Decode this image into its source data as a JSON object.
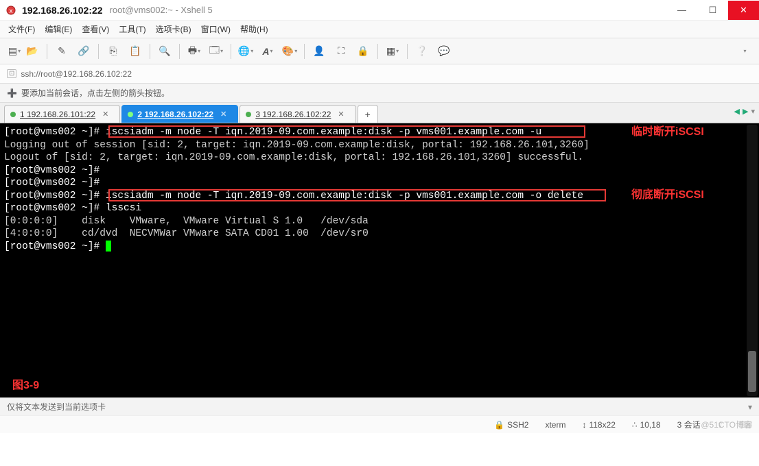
{
  "window": {
    "title_main": "192.168.26.102:22",
    "title_sub": "root@vms002:~ - Xshell 5"
  },
  "menu": {
    "file": "文件(F)",
    "edit": "编辑(E)",
    "view": "查看(V)",
    "tools": "工具(T)",
    "tab": "选项卡(B)",
    "window": "窗口(W)",
    "help": "帮助(H)"
  },
  "address": {
    "protocol_icon": "⍟",
    "url": "ssh://root@192.168.26.102:22"
  },
  "hint": {
    "text": "要添加当前会话，点击左侧的箭头按钮。"
  },
  "tabs": [
    {
      "label": "1 192.168.26.101:22",
      "active": false
    },
    {
      "label": "2 192.168.26.102:22",
      "active": true
    },
    {
      "label": "3 192.168.26.102:22",
      "active": false
    }
  ],
  "terminal": {
    "lines": [
      {
        "prompt": "[root@vms002 ~]#",
        "text": " iscsiadm -m node -T iqn.2019-09.com.example:disk -p vms001.example.com -u"
      },
      {
        "out": "Logging out of session [sid: 2, target: iqn.2019-09.com.example:disk, portal: 192.168.26.101,3260]"
      },
      {
        "out": "Logout of [sid: 2, target: iqn.2019-09.com.example:disk, portal: 192.168.26.101,3260] successful."
      },
      {
        "prompt": "[root@vms002 ~]#",
        "text": ""
      },
      {
        "prompt": "[root@vms002 ~]#",
        "text": ""
      },
      {
        "prompt": "[root@vms002 ~]#",
        "text": " iscsiadm -m node -T iqn.2019-09.com.example:disk -p vms001.example.com -o delete"
      },
      {
        "prompt": "[root@vms002 ~]#",
        "text": " lsscsi"
      },
      {
        "out": "[0:0:0:0]    disk    VMware,  VMware Virtual S 1.0   /dev/sda"
      },
      {
        "out": "[4:0:0:0]    cd/dvd  NECVMWar VMware SATA CD01 1.00  /dev/sr0"
      },
      {
        "prompt": "[root@vms002 ~]#",
        "text": " ",
        "cursor": true
      }
    ],
    "annotation1": "临时断开iSCSI",
    "annotation2": "彻底断开iSCSI",
    "figure_label": "图3-9"
  },
  "sendbar": {
    "text": "仅将文本发送到当前选项卡"
  },
  "status": {
    "proto": "SSH2",
    "term": "xterm",
    "size": "118x22",
    "pos": "10,18",
    "sessions": "3 会话",
    "watermark": "@51CTO博客"
  },
  "icons": {
    "new": "📄",
    "open": "📂",
    "save": "💾",
    "edit": "✎",
    "copy": "⎘",
    "paste": "📋",
    "search": "🔍",
    "print": "🖶",
    "props": "🗔",
    "globe": "🌐",
    "font": "A",
    "palette": "🎨",
    "users": "👤",
    "fullscreen": "⛶",
    "lock": "🔒",
    "grid": "▦",
    "help": "❔",
    "chat": "💬"
  }
}
